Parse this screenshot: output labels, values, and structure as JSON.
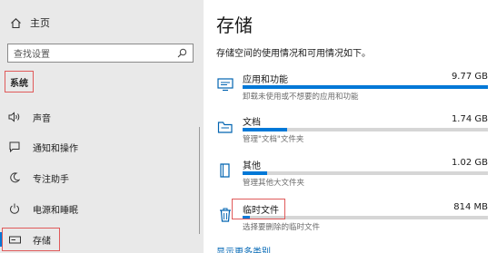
{
  "sidebar": {
    "home_label": "主页",
    "search_placeholder": "查找设置",
    "section_label": "系统",
    "items": [
      {
        "label": "声音",
        "icon": "speaker-icon"
      },
      {
        "label": "通知和操作",
        "icon": "notification-icon"
      },
      {
        "label": "专注助手",
        "icon": "moon-icon"
      },
      {
        "label": "电源和睡眠",
        "icon": "power-icon"
      },
      {
        "label": "存储",
        "icon": "storage-icon",
        "selected": true
      }
    ]
  },
  "main": {
    "title": "存储",
    "subtitle": "存储空间的使用情况和可用情况如下。",
    "categories": [
      {
        "name": "应用和功能",
        "size": "9.77 GB",
        "desc": "卸载未使用或不想要的应用和功能",
        "usage_fraction": 1.0,
        "icon": "apps-icon"
      },
      {
        "name": "文档",
        "size": "1.74 GB",
        "desc": "管理\"文档\"文件夹",
        "usage_fraction": 0.18,
        "icon": "folder-icon"
      },
      {
        "name": "其他",
        "size": "1.02 GB",
        "desc": "管理其他大文件夹",
        "usage_fraction": 0.1,
        "icon": "book-icon"
      },
      {
        "name": "临时文件",
        "size": "814 MB",
        "desc": "选择要删除的临时文件",
        "usage_fraction": 0.03,
        "icon": "trash-icon"
      }
    ],
    "more_link": "显示更多类别"
  },
  "colors": {
    "accent": "#0078d7",
    "highlight_border": "#e05a5a",
    "sidebar_bg": "#e9e9e9"
  }
}
